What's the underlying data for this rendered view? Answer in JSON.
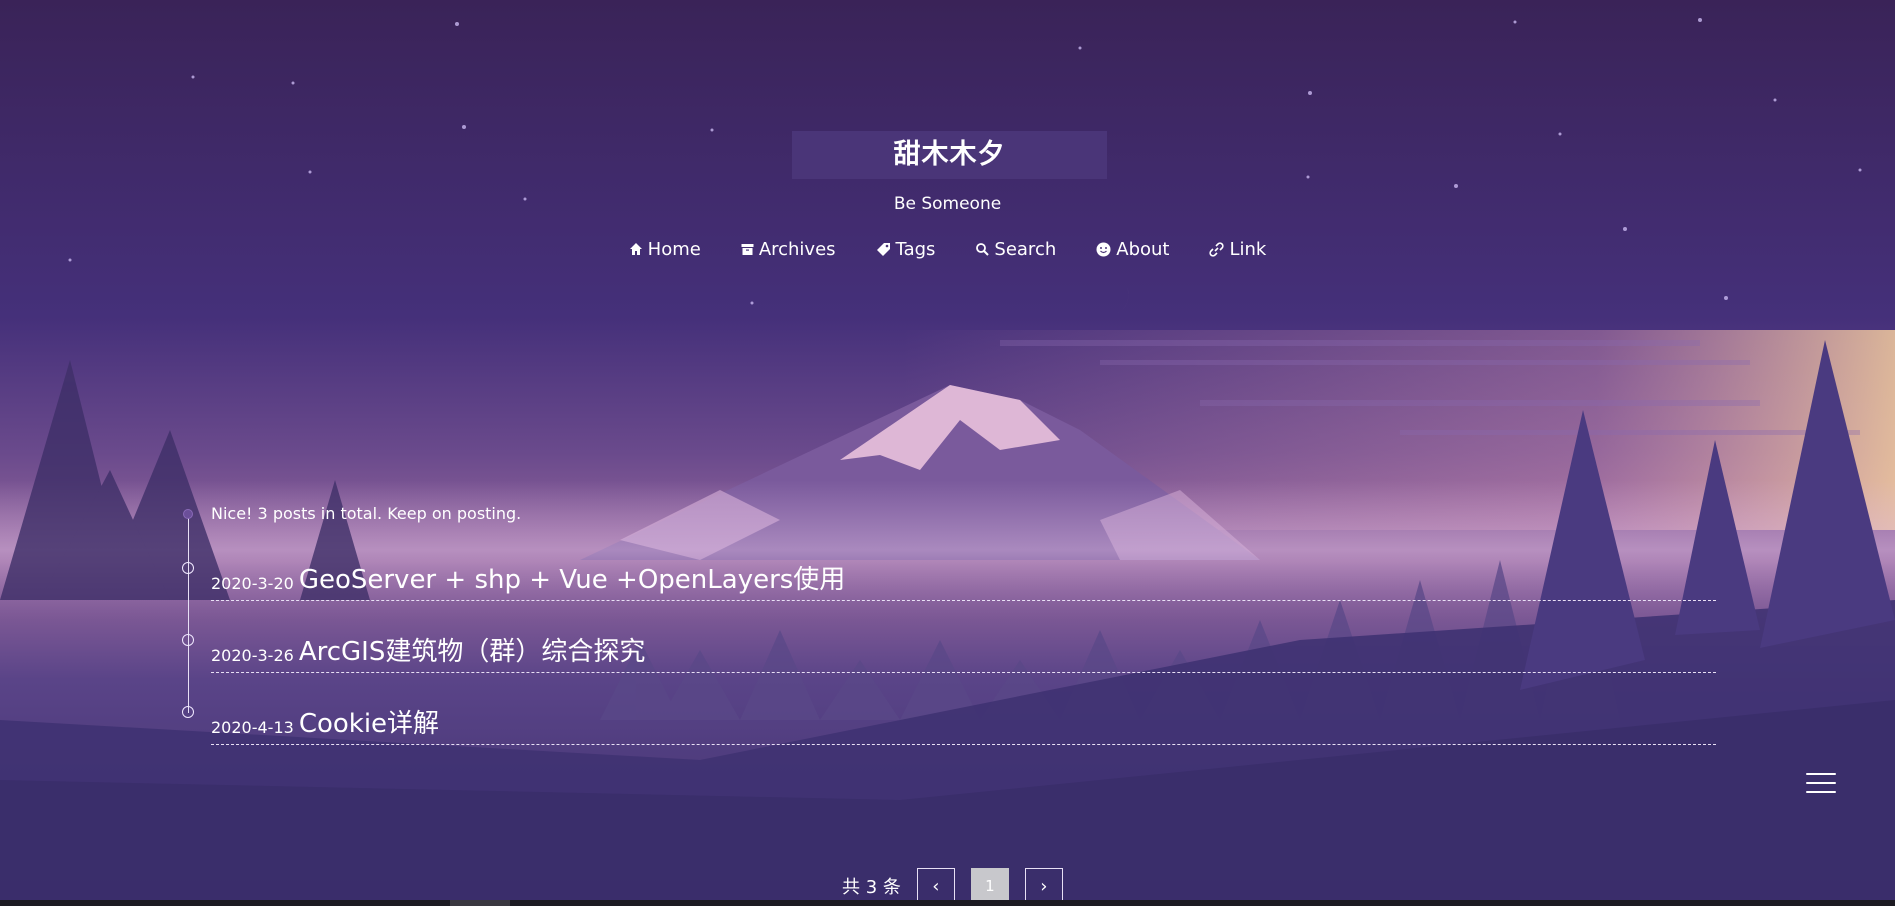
{
  "site": {
    "title": "甜木木夕",
    "subtitle": "Be Someone"
  },
  "nav": [
    {
      "label": "Home",
      "icon": "home-icon"
    },
    {
      "label": "Archives",
      "icon": "archive-icon"
    },
    {
      "label": "Tags",
      "icon": "tag-icon"
    },
    {
      "label": "Search",
      "icon": "search-icon"
    },
    {
      "label": "About",
      "icon": "about-icon"
    },
    {
      "label": "Link",
      "icon": "link-icon"
    }
  ],
  "archive": {
    "summary": "Nice! 3 posts in total. Keep on posting.",
    "posts": [
      {
        "date": "2020-3-20",
        "title": "GeoServer + shp + Vue +OpenLayers使用"
      },
      {
        "date": "2020-3-26",
        "title": "ArcGIS建筑物（群）综合探究"
      },
      {
        "date": "2020-4-13",
        "title": "Cookie详解"
      }
    ]
  },
  "pagination": {
    "total": "共 3 条",
    "prev": "‹",
    "current": "1",
    "next": "›"
  },
  "colors": {
    "sky_top": "#3a2560",
    "sky_mid": "#4a3580",
    "horizon": "#e9a0b8",
    "mountain": "#6a4a90",
    "trees": "#4a3878"
  }
}
